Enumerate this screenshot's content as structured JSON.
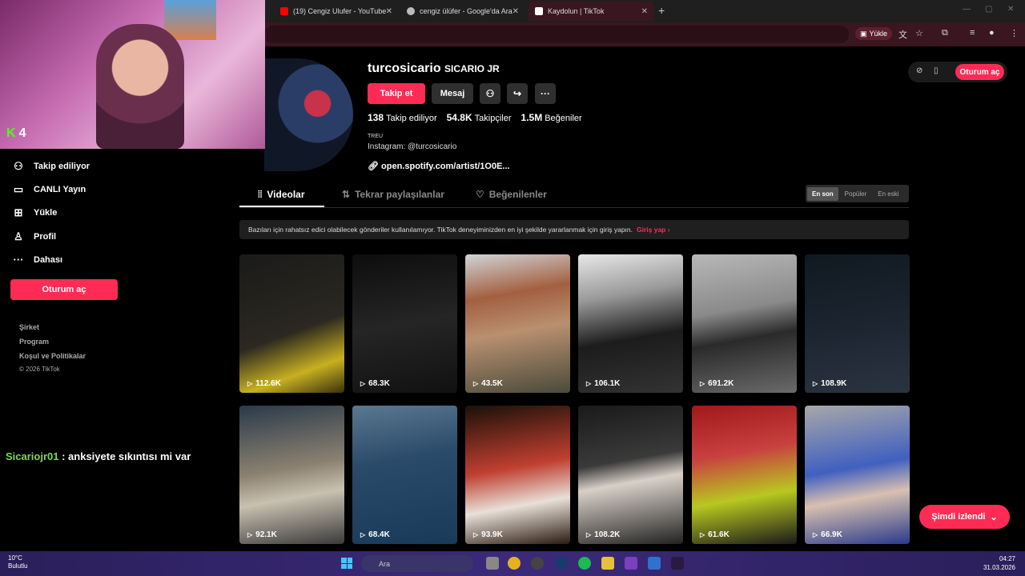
{
  "browser": {
    "tabs": [
      {
        "title": "(19) Cengiz Ulufer - YouTube",
        "color": "#ff0000"
      },
      {
        "title": "cengiz ülüfer - Google'da Ara",
        "color": "#bbbbbb"
      },
      {
        "title": "Kaydolun | TikTok",
        "color": "#ffffff"
      }
    ],
    "new_tab": "+",
    "extension_label": "Yükle"
  },
  "overlay": {
    "kick_count": "4",
    "chat_user": "Sicariojr01",
    "chat_message": " : anksiyete sıkıntısı mi var"
  },
  "sidebar": {
    "items": [
      {
        "label": "Takip ediliyor",
        "icon": "user-follow-icon"
      },
      {
        "label": "CANLI Yayın",
        "icon": "live-tv-icon"
      },
      {
        "label": "Yükle",
        "icon": "upload-plus-icon"
      },
      {
        "label": "Profil",
        "icon": "profile-icon"
      },
      {
        "label": "Dahası",
        "icon": "more-dots-icon"
      }
    ],
    "login_label": "Oturum aç",
    "footer": [
      "Şirket",
      "Program",
      "Koşul ve Politikalar",
      "© 2026 TikTok"
    ]
  },
  "profile": {
    "username": "turcosicario",
    "nickname": "SICARIO JR",
    "follow_label": "Takip et",
    "message_label": "Mesaj",
    "stats": [
      {
        "value": "138",
        "label": "Takip ediliyor"
      },
      {
        "value": "54.8K",
        "label": "Takipçiler"
      },
      {
        "value": "1.5M",
        "label": "Beğeniler"
      }
    ],
    "bio_line1": "TREU",
    "bio_line2": "Instagram: @turcosicario",
    "link": "open.spotify.com/artist/1O0E...",
    "top_login": "Oturum aç"
  },
  "tabs": {
    "videos": "Videolar",
    "reposts": "Tekrar paylaşılanlar",
    "liked": "Beğenilenler",
    "sort": [
      "En son",
      "Popüler",
      "En eski"
    ]
  },
  "banner": {
    "text": "Bazıları için rahatsız edici olabilecek gönderiler kullanılamıyor. TikTok deneyiminizden en iyi şekilde yararlanmak için giriş yapın.",
    "cta": "Giriş yap"
  },
  "videos": [
    {
      "views": "112.6K",
      "bg": "linear-gradient(160deg,#1a1a1a 0%,#2a2820 55%,#c8b020 80%,#3a3010 100%)"
    },
    {
      "views": "68.3K",
      "bg": "linear-gradient(170deg,#0d0d0d,#252525 50%,#111)"
    },
    {
      "views": "43.5K",
      "bg": "linear-gradient(170deg,#d0d4d8 0%,#a36040 30%,#b89070 55%,#4a4a3a 100%)"
    },
    {
      "views": "106.1K",
      "bg": "linear-gradient(170deg,#e8e8e8 0%,#9a9a9a 30%,#1c1c1c 60%,#333 100%)"
    },
    {
      "views": "691.2K",
      "bg": "linear-gradient(170deg,#b8b8b8 0%,#8a8a8a 40%,#2a2a2a 60%,#6a6a6a 100%)"
    },
    {
      "views": "108.9K",
      "bg": "linear-gradient(170deg,#101820 0%,#1c2430 50%,#2a3440 100%)"
    },
    {
      "views": "92.1K",
      "bg": "linear-gradient(170deg,#2a3a4a 0%,#8a8070 45%,#c8c0b0 65%,#3a3a3a 100%)"
    },
    {
      "views": "68.4K",
      "bg": "linear-gradient(170deg,#5a7890 0%,#2a4a6a 40%,#1a3a5a 100%)"
    },
    {
      "views": "93.9K",
      "bg": "linear-gradient(170deg,#1a1008 0%,#c04030 45%,#e8e0d8 70%,#2a1a10 100%)"
    },
    {
      "views": "108.2K",
      "bg": "linear-gradient(170deg,#1a1a1a 0%,#3a3a3a 40%,#d8d0c8 55%,#222 100%)"
    },
    {
      "views": "61.6K",
      "bg": "linear-gradient(170deg,#a01818 0%,#c84040 35%,#b8c820 65%,#1a1a1a 100%)"
    },
    {
      "views": "66.9K",
      "bg": "linear-gradient(170deg,#a8a8a8 0%,#4060c0 45%,#d8c0b0 65%,#2a3a8a 100%)"
    }
  ],
  "watched_label": "Şimdi izlendi",
  "taskbar": {
    "temp": "10°C",
    "weather": "Bulutlu",
    "search_placeholder": "Ara",
    "time": "04:27",
    "date": "31.03.2026"
  },
  "colors": {
    "accent": "#fe2c55",
    "kick": "#53fc18",
    "chat_user": "#7ed957"
  }
}
